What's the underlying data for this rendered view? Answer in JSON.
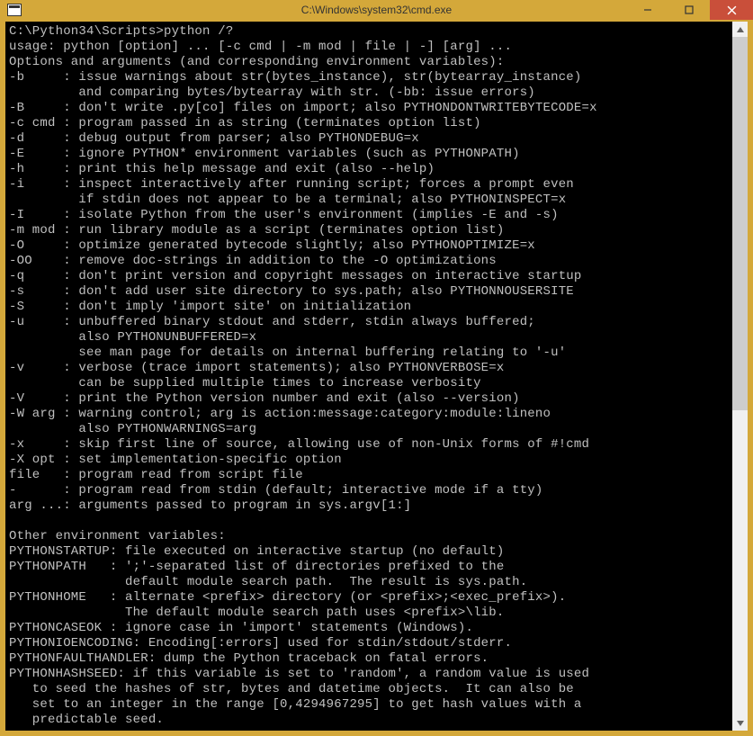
{
  "window": {
    "title": "C:\\Windows\\system32\\cmd.exe"
  },
  "terminal": {
    "lines": [
      "C:\\Python34\\Scripts>python /?",
      "usage: python [option] ... [-c cmd | -m mod | file | -] [arg] ...",
      "Options and arguments (and corresponding environment variables):",
      "-b     : issue warnings about str(bytes_instance), str(bytearray_instance)",
      "         and comparing bytes/bytearray with str. (-bb: issue errors)",
      "-B     : don't write .py[co] files on import; also PYTHONDONTWRITEBYTECODE=x",
      "-c cmd : program passed in as string (terminates option list)",
      "-d     : debug output from parser; also PYTHONDEBUG=x",
      "-E     : ignore PYTHON* environment variables (such as PYTHONPATH)",
      "-h     : print this help message and exit (also --help)",
      "-i     : inspect interactively after running script; forces a prompt even",
      "         if stdin does not appear to be a terminal; also PYTHONINSPECT=x",
      "-I     : isolate Python from the user's environment (implies -E and -s)",
      "-m mod : run library module as a script (terminates option list)",
      "-O     : optimize generated bytecode slightly; also PYTHONOPTIMIZE=x",
      "-OO    : remove doc-strings in addition to the -O optimizations",
      "-q     : don't print version and copyright messages on interactive startup",
      "-s     : don't add user site directory to sys.path; also PYTHONNOUSERSITE",
      "-S     : don't imply 'import site' on initialization",
      "-u     : unbuffered binary stdout and stderr, stdin always buffered;",
      "         also PYTHONUNBUFFERED=x",
      "         see man page for details on internal buffering relating to '-u'",
      "-v     : verbose (trace import statements); also PYTHONVERBOSE=x",
      "         can be supplied multiple times to increase verbosity",
      "-V     : print the Python version number and exit (also --version)",
      "-W arg : warning control; arg is action:message:category:module:lineno",
      "         also PYTHONWARNINGS=arg",
      "-x     : skip first line of source, allowing use of non-Unix forms of #!cmd",
      "-X opt : set implementation-specific option",
      "file   : program read from script file",
      "-      : program read from stdin (default; interactive mode if a tty)",
      "arg ...: arguments passed to program in sys.argv[1:]",
      "",
      "Other environment variables:",
      "PYTHONSTARTUP: file executed on interactive startup (no default)",
      "PYTHONPATH   : ';'-separated list of directories prefixed to the",
      "               default module search path.  The result is sys.path.",
      "PYTHONHOME   : alternate <prefix> directory (or <prefix>;<exec_prefix>).",
      "               The default module search path uses <prefix>\\lib.",
      "PYTHONCASEOK : ignore case in 'import' statements (Windows).",
      "PYTHONIOENCODING: Encoding[:errors] used for stdin/stdout/stderr.",
      "PYTHONFAULTHANDLER: dump the Python traceback on fatal errors.",
      "PYTHONHASHSEED: if this variable is set to 'random', a random value is used",
      "   to seed the hashes of str, bytes and datetime objects.  It can also be",
      "   set to an integer in the range [0,4294967295] to get hash values with a",
      "   predictable seed."
    ]
  }
}
